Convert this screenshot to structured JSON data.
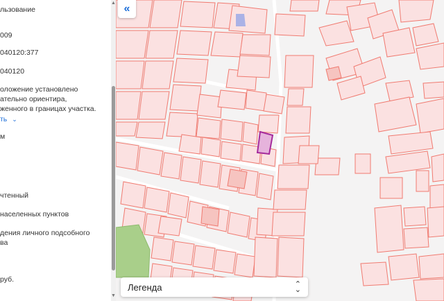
{
  "sidebar": {
    "lines": [
      "льзование",
      "009",
      "040120:377",
      "040120",
      "оложение установлено",
      "ательно ориентира,",
      "женного в границах участка.",
      "ть",
      "м",
      "чтенный",
      "населенных пунктов",
      "дения личного подсобного",
      "ва",
      "руб."
    ],
    "link_chevron": "⌄"
  },
  "controls": {
    "collapse_glyph": "«",
    "legend_label": "Легенда",
    "legend_chevron_up": "⌃",
    "legend_chevron_down": "⌄",
    "scroll_up": "▲",
    "scroll_down": "▼"
  },
  "colors": {
    "parcel_fill": "#fbe1e1",
    "parcel_border": "#f07a70",
    "selected_fill": "#e6b3dc",
    "selected_border": "#a52b9c",
    "green_area": "#a9cf8a",
    "water": "#aab2e6",
    "background": "#f4f3f3"
  }
}
